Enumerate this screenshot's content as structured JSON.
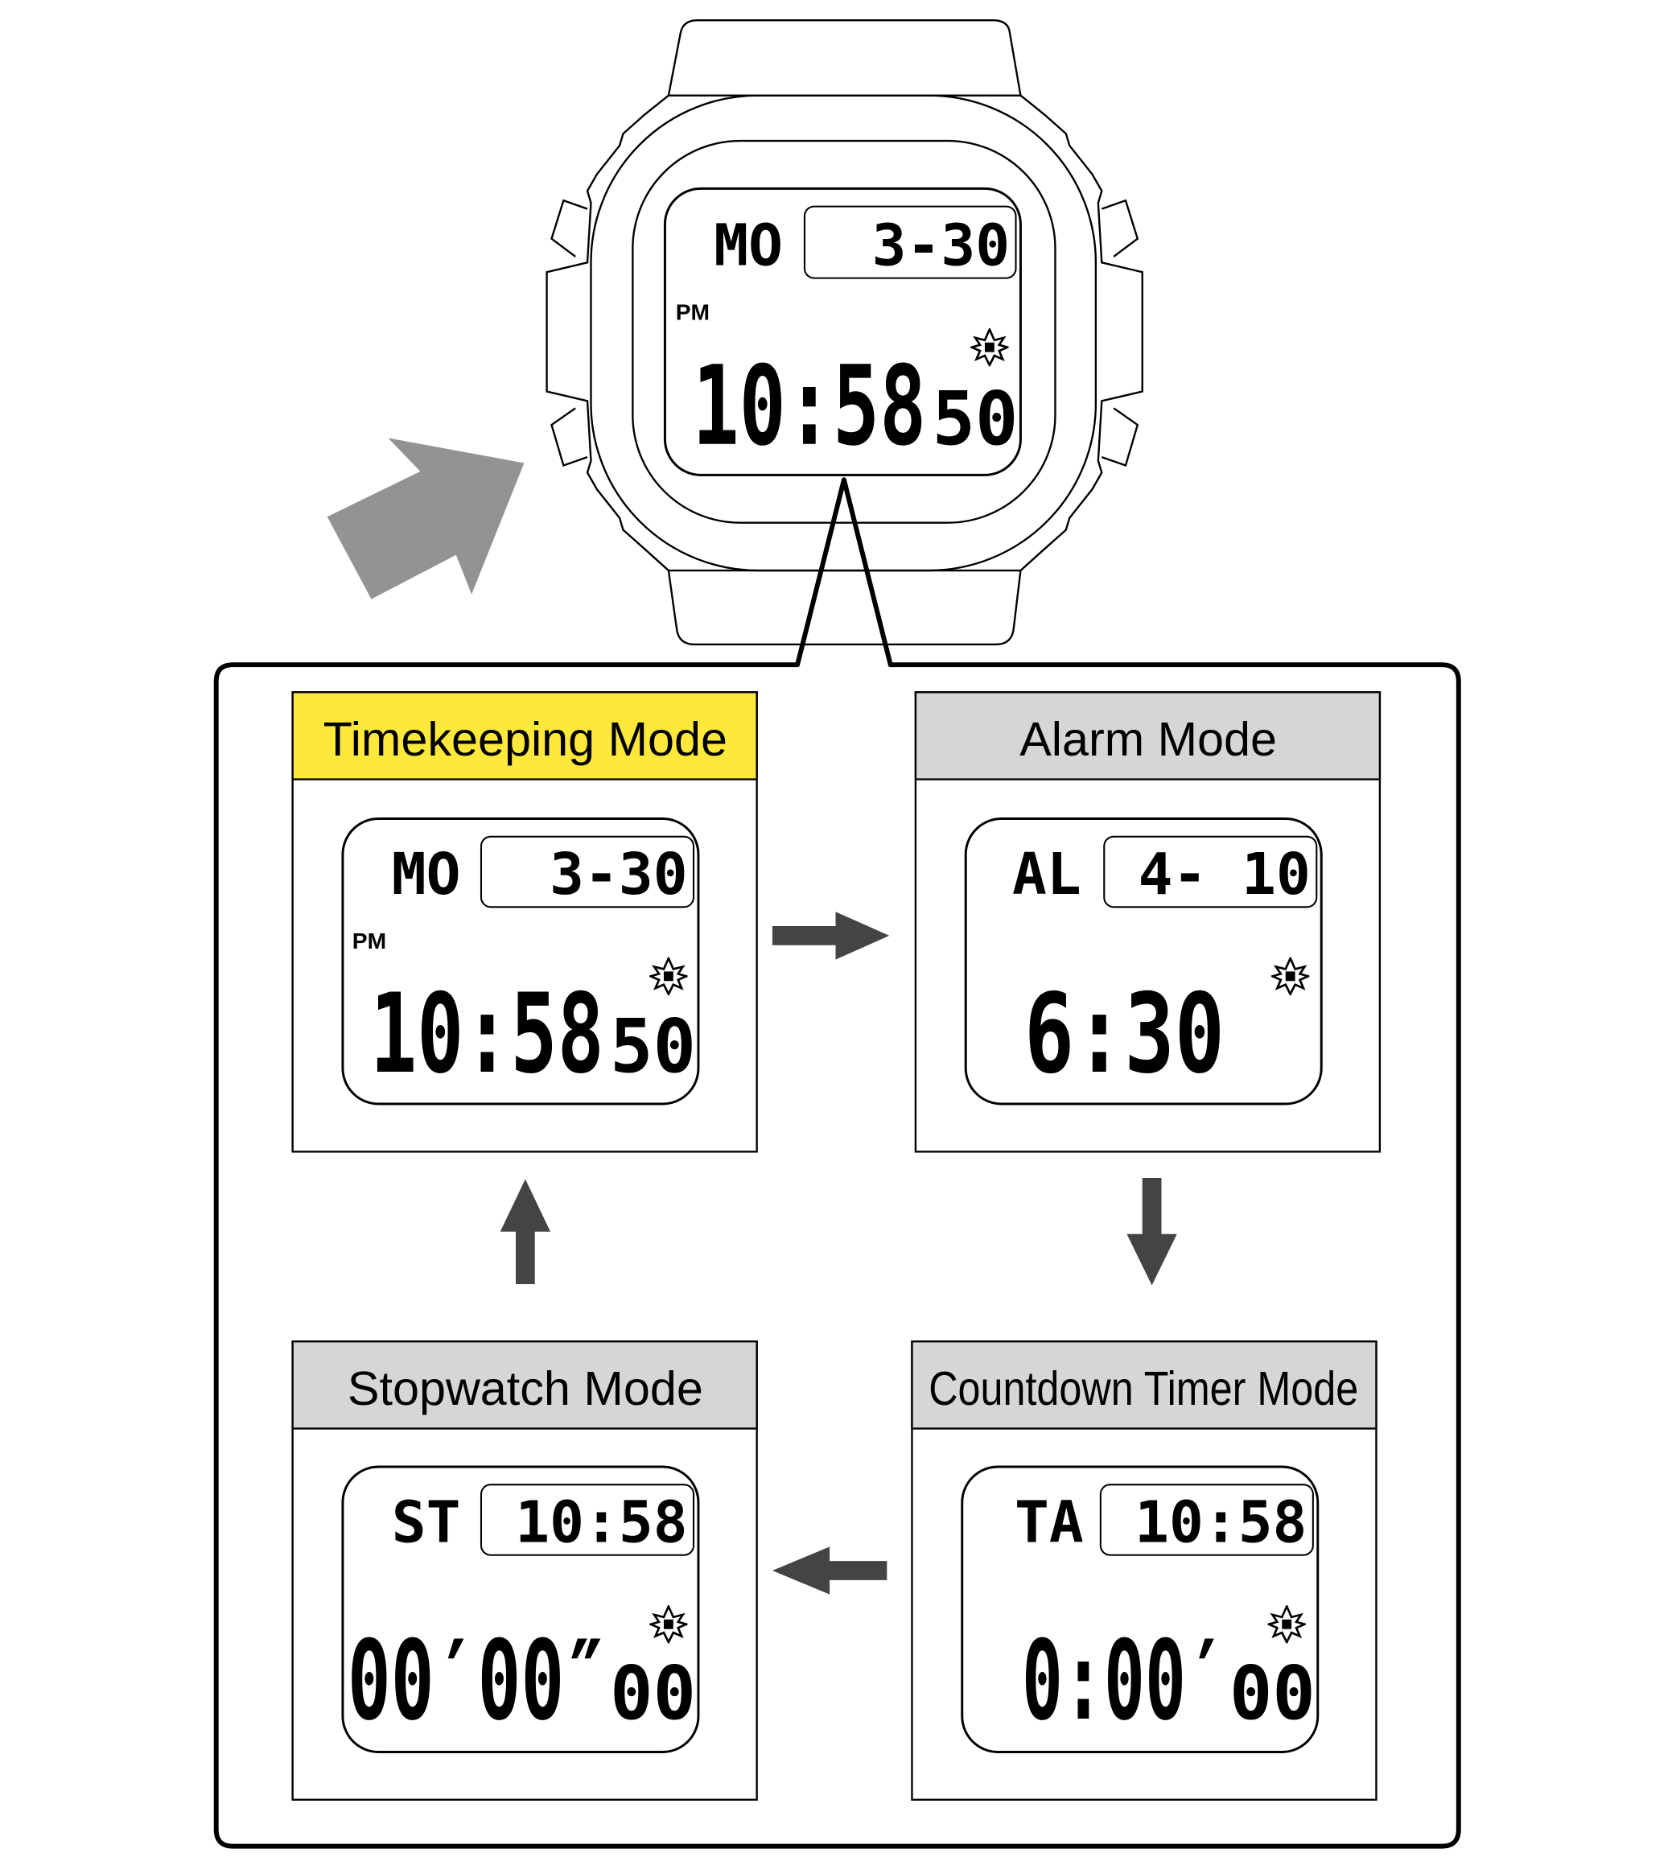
{
  "colors": {
    "active_header": "#FFE83C",
    "inactive_header": "#D6D6D6",
    "flow_arrow": "#444444",
    "pointer_arrow": "#939393"
  },
  "watch": {
    "day": "MO",
    "date": "3-30",
    "pm": "PM",
    "time": "10:58",
    "seconds": "50",
    "icon": "light-icon"
  },
  "modes": [
    {
      "title": "Timekeeping Mode",
      "active": true,
      "label": "MO",
      "top": "3-30",
      "pm": "PM",
      "main": "10:58",
      "small": "50"
    },
    {
      "title": "Alarm Mode",
      "active": false,
      "label": "AL",
      "top": "4- 10",
      "main": "6:30",
      "small": ""
    },
    {
      "title": "Countdown Timer Mode",
      "active": false,
      "label": "TA",
      "top": "10:58",
      "main": "0:00′",
      "small": "00"
    },
    {
      "title": "Stopwatch Mode",
      "active": false,
      "label": "ST",
      "top": "10:58",
      "main": "00′00″",
      "small": "00"
    }
  ],
  "flow": [
    "Timekeeping Mode",
    "Alarm Mode",
    "Countdown Timer Mode",
    "Stopwatch Mode"
  ]
}
